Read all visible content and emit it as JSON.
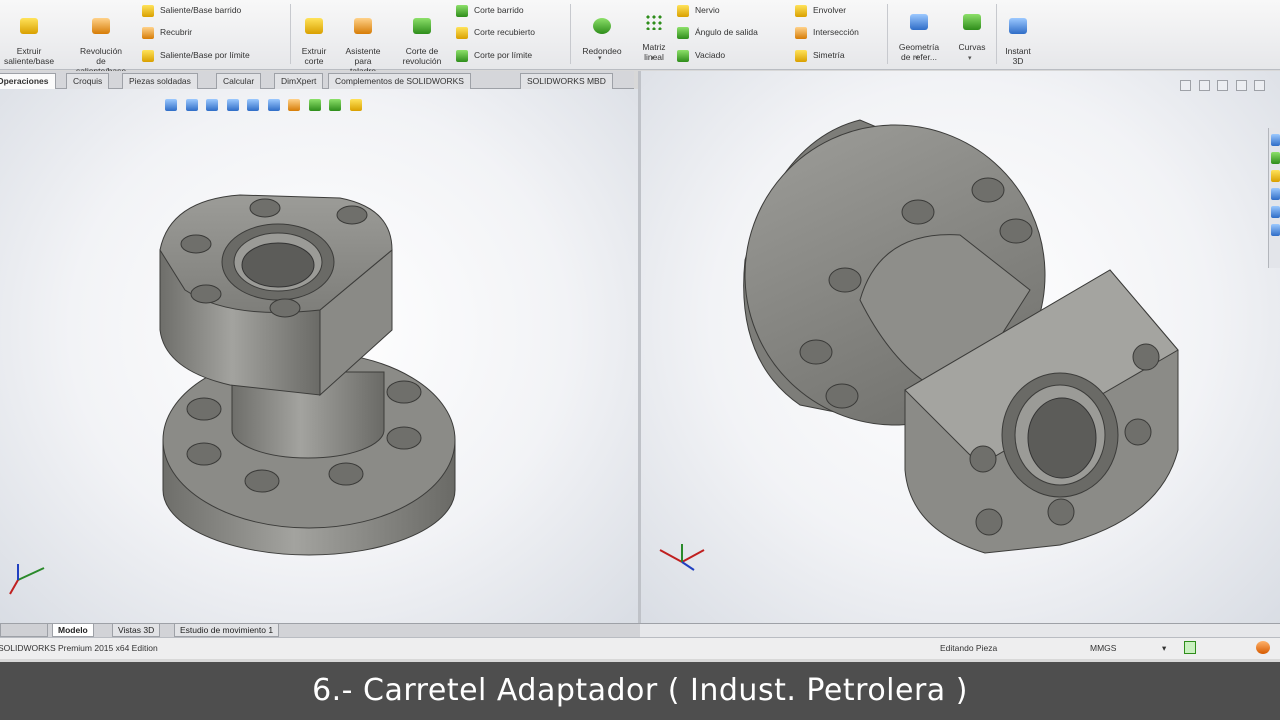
{
  "ribbon": {
    "extruir": "Extruir\nsaliente/base",
    "revolucion": "Revolución\nde\nsaliente/base",
    "barrido": "Saliente/Base barrido",
    "recubrir": "Recubrir",
    "por_limite": "Saliente/Base por límite",
    "extruir_corte": "Extruir\ncorte",
    "asistente": "Asistente\npara\ntaladro",
    "corte_revolucion": "Corte de\nrevolución",
    "corte_barrido": "Corte barrido",
    "corte_recubierto": "Corte recubierto",
    "corte_limite": "Corte por límite",
    "redondeo": "Redondeo",
    "matriz": "Matriz\nlineal",
    "nervio": "Nervio",
    "angulo": "Ángulo de salida",
    "vaciado": "Vaciado",
    "envolver": "Envolver",
    "interseccion": "Intersección",
    "simetria": "Simetría",
    "geometria": "Geometría\nde refer...",
    "curvas": "Curvas",
    "instant3d": "Instant\n3D"
  },
  "tabs": [
    "Operaciones",
    "Croquis",
    "Piezas soldadas",
    "Calcular",
    "DimXpert",
    "Complementos de SOLIDWORKS",
    "SOLIDWORKS MBD"
  ],
  "bottom_tabs": [
    "Modelo",
    "Vistas 3D",
    "Estudio de movimiento 1"
  ],
  "status": {
    "edition": "SOLIDWORKS Premium 2015 x64 Edition",
    "mode": "Editando Pieza",
    "units": "MMGS"
  },
  "caption": "6.- Carretel Adaptador ( Indust. Petrolera )",
  "colors": {
    "ribbon_bg": "#eceef1",
    "viewport_bg": "#f4f5f7",
    "part": "#8a8a86",
    "caption_bg": "#4e4e4e"
  },
  "icons": [
    "extrude-icon",
    "revolve-icon",
    "sweep-icon",
    "loft-icon",
    "boundary-icon",
    "cut-extrude-icon",
    "hole-wizard-icon",
    "cut-revolve-icon",
    "fillet-icon",
    "linear-pattern-icon",
    "rib-icon",
    "draft-icon",
    "shell-icon",
    "wrap-icon",
    "intersect-icon",
    "mirror-icon",
    "reference-geometry-icon",
    "curves-icon",
    "instant3d-icon"
  ]
}
